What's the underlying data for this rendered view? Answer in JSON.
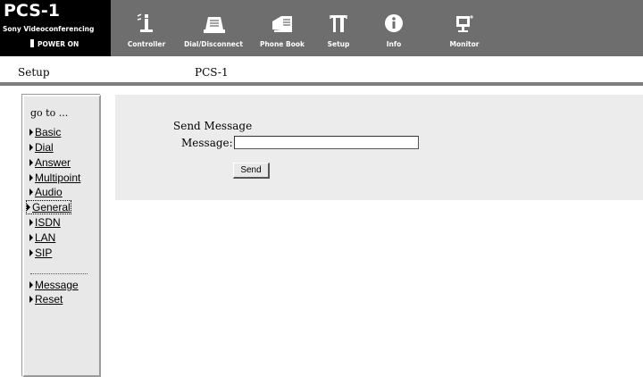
{
  "brand": {
    "title": "PCS-1",
    "subtitle": "Sony Videoconferencing",
    "power_status": "POWER ON"
  },
  "toolbar": [
    {
      "label": "Controller",
      "icon": "controller-icon"
    },
    {
      "label": "Dial/Disconnect",
      "icon": "dial-disconnect-icon"
    },
    {
      "label": "Phone Book",
      "icon": "phone-book-icon"
    },
    {
      "label": "Setup",
      "icon": "setup-icon"
    },
    {
      "label": "Info",
      "icon": "info-icon"
    },
    {
      "label": "Monitor",
      "icon": "monitor-icon"
    }
  ],
  "page": {
    "section": "Setup",
    "device": "PCS-1"
  },
  "sidebar": {
    "heading": "go to ...",
    "items": [
      {
        "label": "Basic"
      },
      {
        "label": "Dial"
      },
      {
        "label": "Answer"
      },
      {
        "label": "Multipoint"
      },
      {
        "label": "Audio"
      },
      {
        "label": "General"
      },
      {
        "label": "ISDN"
      },
      {
        "label": "LAN"
      },
      {
        "label": "SIP"
      },
      {
        "label": "Message"
      },
      {
        "label": "Reset"
      }
    ]
  },
  "form": {
    "title": "Send Message",
    "message_label": "Message:",
    "message_value": "",
    "send_label": "Send"
  },
  "colors": {
    "banner": "#6e6e6e",
    "brand_bg": "#000000",
    "panel_bg": "#ececec",
    "sidebar_bg": "#e8e8e8"
  }
}
